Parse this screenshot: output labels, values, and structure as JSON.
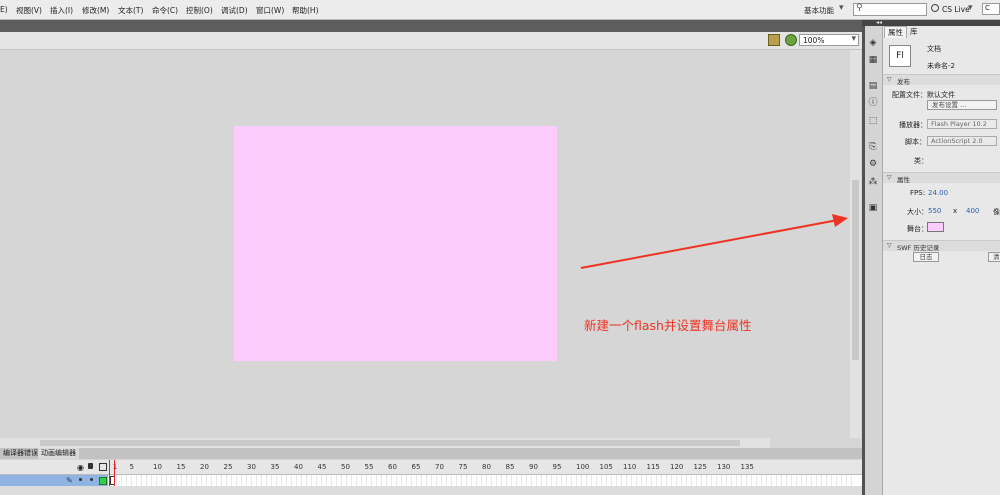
{
  "menu": {
    "items": [
      "E)",
      "视图(V)",
      "插入(I)",
      "修改(M)",
      "文本(T)",
      "命令(C)",
      "控制(O)",
      "调试(D)",
      "窗口(W)",
      "帮助(H)"
    ],
    "workspace": "基本功能",
    "cs_live": "CS Live",
    "help_box": "C"
  },
  "editbar": {
    "zoom": "100%"
  },
  "stage": {
    "color": "#fcccff"
  },
  "annotation": {
    "text": "新建一个flash并设置舞台属性",
    "color": "#ee3322"
  },
  "timeline": {
    "tabs": [
      "编译器错误",
      "动画编辑器"
    ],
    "frame_numbers": [
      "1",
      "5",
      "10",
      "15",
      "20",
      "25",
      "30",
      "35",
      "40",
      "45",
      "50",
      "55",
      "60",
      "65",
      "70",
      "75",
      "80",
      "85",
      "90",
      "95",
      "100",
      "105",
      "110",
      "115",
      "120",
      "125",
      "130",
      "135"
    ]
  },
  "properties": {
    "tabs": [
      "属性",
      "库"
    ],
    "doc_icon": "Fl",
    "doc_type": "文档",
    "doc_name": "未命名-2",
    "publish": {
      "header": "发布",
      "profile_label": "配置文件：",
      "profile_value": "默认文件",
      "settings_button": "发布设置 ...",
      "player_label": "播放器：",
      "player_value": "Flash Player 10.2",
      "script_label": "脚本：",
      "script_value": "ActionScript 2.0",
      "class_label": "类："
    },
    "attributes": {
      "header": "属性",
      "fps_label": "FPS:",
      "fps_value": "24.00",
      "size_label": "大小：",
      "width": "550",
      "x_sep": "x",
      "height": "400",
      "unit": "像",
      "stage_label": "舞台：",
      "stage_color": "#fcccff"
    },
    "swf_history": {
      "header": "SWF 历史记录",
      "log_button": "日志",
      "clear_button": "清"
    }
  }
}
